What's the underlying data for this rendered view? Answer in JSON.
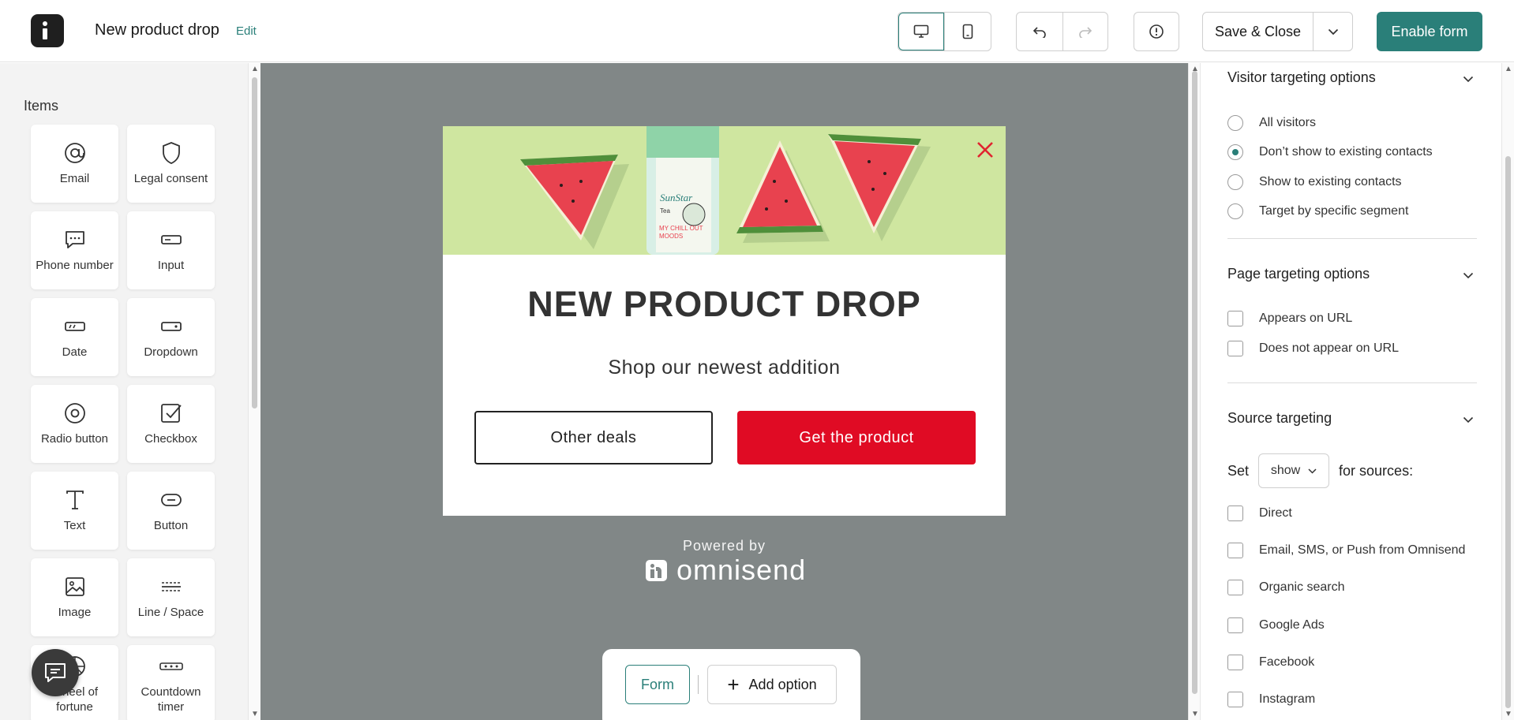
{
  "header": {
    "title": "New product drop",
    "edit_label": "Edit",
    "save_close_label": "Save & Close",
    "enable_label": "Enable form"
  },
  "left_panel": {
    "heading": "Items",
    "items": [
      {
        "label": "Email",
        "icon": "at-icon"
      },
      {
        "label": "Legal consent",
        "icon": "shield-icon"
      },
      {
        "label": "Phone number",
        "icon": "message-icon"
      },
      {
        "label": "Input",
        "icon": "input-icon"
      },
      {
        "label": "Date",
        "icon": "date-icon"
      },
      {
        "label": "Dropdown",
        "icon": "dropdown-icon"
      },
      {
        "label": "Radio button",
        "icon": "radio-icon"
      },
      {
        "label": "Checkbox",
        "icon": "checkbox-icon"
      },
      {
        "label": "Text",
        "icon": "text-icon"
      },
      {
        "label": "Button",
        "icon": "button-icon"
      },
      {
        "label": "Image",
        "icon": "image-icon"
      },
      {
        "label": "Line / Space",
        "icon": "line-space-icon"
      },
      {
        "label": "Wheel of fortune",
        "icon": "wheel-icon"
      },
      {
        "label": "Countdown timer",
        "icon": "timer-icon"
      }
    ]
  },
  "popup": {
    "headline": "NEW PRODUCT DROP",
    "subline": "Shop our newest addition",
    "secondary_button": "Other deals",
    "primary_button": "Get the product",
    "accent_color": "#e00b24",
    "can_label_1": "SunStar",
    "can_label_2": "Tea",
    "can_label_3": "MY CHILL OUT",
    "can_label_4": "MOODS"
  },
  "canvas": {
    "powered_by": "Powered by",
    "brand": "omnisend",
    "form_tab": "Form",
    "add_option": "Add option"
  },
  "right_panel": {
    "visitor_title": "Visitor targeting options",
    "visitor_options": [
      {
        "label": "All visitors",
        "selected": false
      },
      {
        "label": "Don’t show to existing contacts",
        "selected": true
      },
      {
        "label": "Show to existing contacts",
        "selected": false
      },
      {
        "label": "Target by specific segment",
        "selected": false
      }
    ],
    "page_title": "Page targeting options",
    "page_options": [
      "Appears on URL",
      "Does not appear on URL"
    ],
    "source_title": "Source targeting",
    "set_label": "Set",
    "set_value": "show",
    "for_sources_label": "for sources:",
    "sources": [
      "Direct",
      "Email, SMS, or Push from Omnisend",
      "Organic search",
      "Google Ads",
      "Facebook",
      "Instagram"
    ]
  },
  "colors": {
    "brand_teal": "#2a7f79",
    "canvas_gray": "#818787",
    "banner_green": "#cfe6a0"
  }
}
